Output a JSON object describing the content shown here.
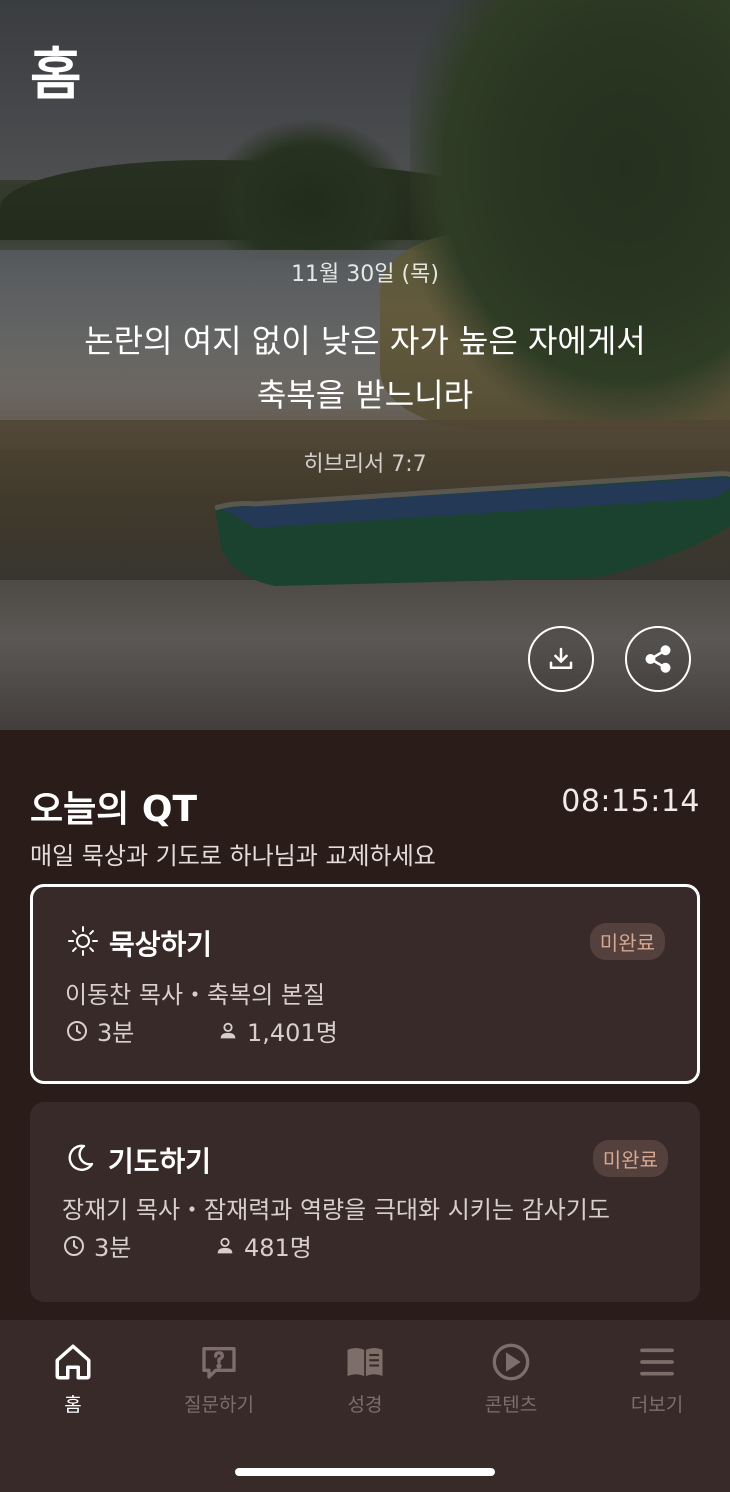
{
  "header": {
    "title": "홈"
  },
  "hero": {
    "date": "11월 30일 (목)",
    "verse_line1": "논란의 여지 없이 낮은 자가 높은 자에게서",
    "verse_line2": "축복을 받느니라",
    "reference": "히브리서 7:7",
    "actions": {
      "download_icon": "download-icon",
      "share_icon": "share-icon"
    }
  },
  "qt": {
    "title": "오늘의 QT",
    "timer": "08:15:14",
    "subtitle": "매일 묵상과 기도로 하나님과 교제하세요",
    "cards": [
      {
        "icon": "sun-icon",
        "title": "묵상하기",
        "badge": "미완료",
        "description": "이동찬 목사・축복의 본질",
        "duration": "3분",
        "participants": "1,401명"
      },
      {
        "icon": "moon-icon",
        "title": "기도하기",
        "badge": "미완료",
        "description": "장재기 목사・잠재력과 역량을 극대화 시키는 감사기도",
        "duration": "3분",
        "participants": "481명"
      }
    ]
  },
  "nav": {
    "items": [
      {
        "label": "홈",
        "icon": "home-icon",
        "active": true
      },
      {
        "label": "질문하기",
        "icon": "question-icon",
        "active": false
      },
      {
        "label": "성경",
        "icon": "book-icon",
        "active": false
      },
      {
        "label": "콘텐츠",
        "icon": "play-icon",
        "active": false
      },
      {
        "label": "더보기",
        "icon": "menu-icon",
        "active": false
      }
    ]
  },
  "colors": {
    "background": "#2a1c19",
    "card": "#382a28",
    "badge_text": "#d4a892",
    "nav_inactive": "#7d6e6a"
  }
}
